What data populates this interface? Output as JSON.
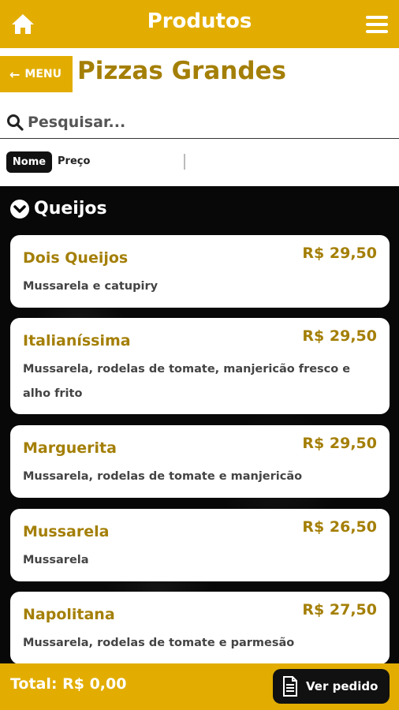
{
  "header": {
    "title": "Produtos",
    "home_icon": "home-icon",
    "menu_icon": "hamburger-menu-icon"
  },
  "nav": {
    "menu_button": "MENU",
    "page_title": "Pizzas Grandes"
  },
  "search": {
    "placeholder": "Pesquisar..."
  },
  "sort": {
    "options": [
      "Nome",
      "Preço"
    ],
    "active": "Nome"
  },
  "category": {
    "name": "Queijos"
  },
  "products": [
    {
      "name": "Dois Queijos",
      "price": "R$ 29,50",
      "description": "Mussarela e catupiry"
    },
    {
      "name": "Italianíssima",
      "price": "R$ 29,50",
      "description": "Mussarela, rodelas de tomate, manjericão fresco e alho frito"
    },
    {
      "name": "Marguerita",
      "price": "R$ 29,50",
      "description": "Mussarela, rodelas de tomate e manjericão"
    },
    {
      "name": "Mussarela",
      "price": "R$ 26,50",
      "description": "Mussarela"
    },
    {
      "name": "Napolitana",
      "price": "R$ 27,50",
      "description": "Mussarela, rodelas de tomate e parmesão"
    }
  ],
  "footer": {
    "total": "Total: R$ 0,00",
    "order_button": "Ver pedido"
  },
  "colors": {
    "brand": "#e2ad00",
    "title_text": "#a47f06",
    "dark": "#111111"
  }
}
